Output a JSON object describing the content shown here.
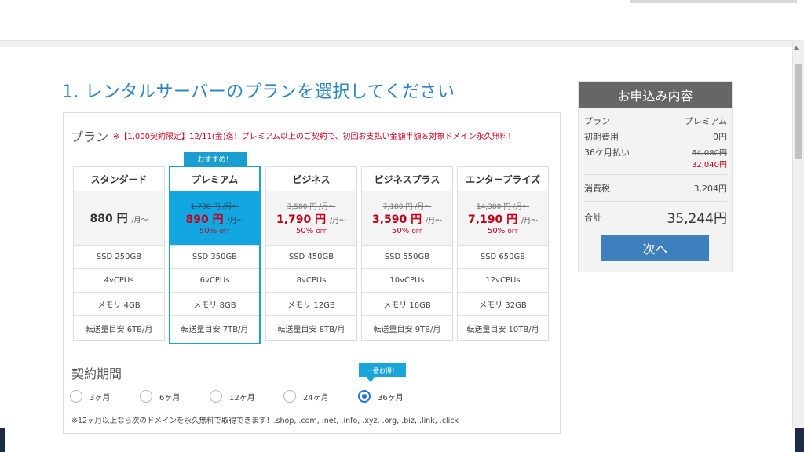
{
  "heading": "1. レンタルサーバーのプランを選択してください",
  "plan_section": {
    "label": "プラン",
    "promo": "※【1,000契約限定】12/11(金)迄！プレミアム以上のご契約で、初回お支払い金額半額＆対象ドメイン永久無料！",
    "featured_badge": "おすすめ！",
    "plans": [
      {
        "name": "スタンダード",
        "base_price": "880 円",
        "per": "/月～",
        "ssd": "SSD 250GB",
        "cpu": "4vCPUs",
        "memory": "メモリ 4GB",
        "transfer": "転送量目安 6TB/月"
      },
      {
        "name": "プレミアム",
        "old_price": "1,780 円 /月～",
        "new_price": "890 円",
        "per": "/月～",
        "discount": "50%",
        "off": "OFF",
        "ssd": "SSD 350GB",
        "cpu": "6vCPUs",
        "memory": "メモリ 8GB",
        "transfer": "転送量目安 7TB/月",
        "selected": true
      },
      {
        "name": "ビジネス",
        "old_price": "3,580 円 /月～",
        "new_price": "1,790 円",
        "per": "/月～",
        "discount": "50%",
        "off": "OFF",
        "ssd": "SSD 450GB",
        "cpu": "8vCPUs",
        "memory": "メモリ 12GB",
        "transfer": "転送量目安 8TB/月"
      },
      {
        "name": "ビジネスプラス",
        "old_price": "7,180 円 /月～",
        "new_price": "3,590 円",
        "per": "/月～",
        "discount": "50%",
        "off": "OFF",
        "ssd": "SSD 550GB",
        "cpu": "10vCPUs",
        "memory": "メモリ 16GB",
        "transfer": "転送量目安 9TB/月"
      },
      {
        "name": "エンタープライズ",
        "old_price": "14,380 円 /月～",
        "new_price": "7,190 円",
        "per": "/月～",
        "discount": "50%",
        "off": "OFF",
        "ssd": "SSD 650GB",
        "cpu": "12vCPUs",
        "memory": "メモリ 32GB",
        "transfer": "転送量目安 10TB/月"
      }
    ]
  },
  "contract": {
    "label": "契約期間",
    "best_badge": "一番お得！",
    "options": [
      {
        "label": "3ヶ月",
        "checked": false
      },
      {
        "label": "6ヶ月",
        "checked": false
      },
      {
        "label": "12ヶ月",
        "checked": false
      },
      {
        "label": "24ヶ月",
        "checked": false
      },
      {
        "label": "36ヶ月",
        "checked": true
      }
    ],
    "note": "※12ヶ月以上なら次のドメインを永久無料で取得できます！.shop, .com, .net, .info, .xyz, .org, .biz, .link, .click"
  },
  "order": {
    "title": "お申込み内容",
    "plan_label": "プラン",
    "plan_value": "プレミアム",
    "initial_label": "初期費用",
    "initial_value": "0円",
    "payment_label": "36ケ月払い",
    "payment_old": "64,080円",
    "payment_new": "32,040円",
    "tax_label": "消費税",
    "tax_value": "3,204円",
    "total_label": "合計",
    "total_value": "35,244円",
    "next_button": "次へ"
  },
  "colors": {
    "accent_blue": "#13a7e2",
    "heading_blue": "#2e86c1",
    "price_red": "#c2001b",
    "button_blue": "#3f7fbd",
    "order_header": "#666666"
  }
}
